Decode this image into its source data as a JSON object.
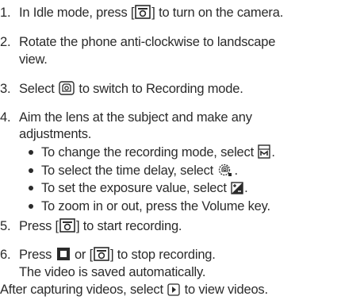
{
  "steps": [
    {
      "num": "1.",
      "before": "In Idle mode, press [",
      "after": "] to turn on the camera."
    },
    {
      "num": "2.",
      "line1": "Rotate the phone anti-clockwise to landscape",
      "line2": "view."
    },
    {
      "num": "3.",
      "before": "Select ",
      "after": " to switch to Recording mode."
    },
    {
      "num": "4.",
      "line1": "Aim the lens at the subject and make any",
      "line2": "adjustments."
    },
    {
      "num": "5.",
      "before": "Press [",
      "after": "] to start recording."
    },
    {
      "num": "6.",
      "before": "Press ",
      "mid": " or [",
      "after": "] to stop recording.",
      "line2": "The video is saved automatically."
    }
  ],
  "substeps": [
    {
      "before": "To change the recording mode, select ",
      "after": "."
    },
    {
      "before": "To select the time delay, select ",
      "after": "."
    },
    {
      "before": "To set the exposure value, select ",
      "after": "."
    },
    {
      "text": "To zoom in or out, press the Volume key."
    }
  ],
  "footer": {
    "before": "After capturing videos, select ",
    "after": " to view videos."
  },
  "icons": {
    "camera_key": "camera-key-icon",
    "camera_switch": "camera-switch-icon",
    "recording_mode": "recording-mode-icon",
    "timer": "timer-icon",
    "exposure": "exposure-icon",
    "stop": "stop-icon",
    "play": "play-icon"
  }
}
